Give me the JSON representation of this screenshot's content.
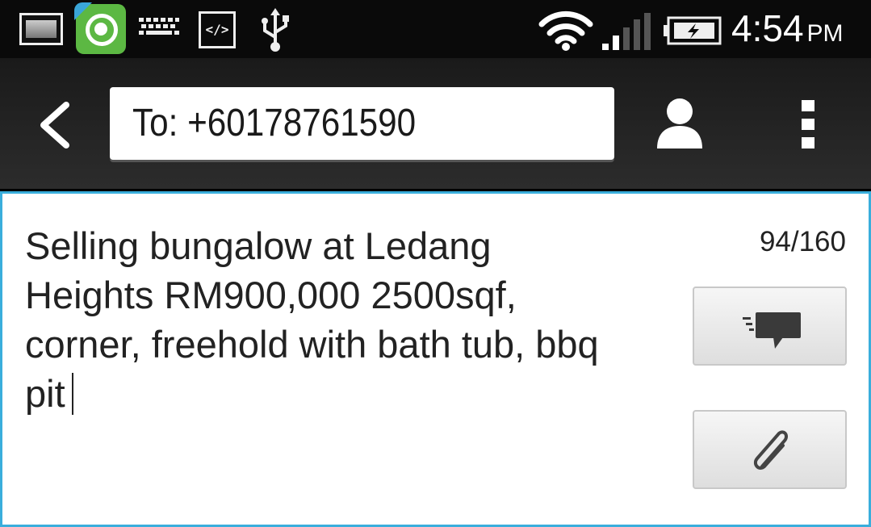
{
  "status_bar": {
    "time": "4:54",
    "ampm": "PM",
    "notification_icons": [
      "gallery-icon",
      "app-pro-icon",
      "keyboard-icon",
      "code-icon",
      "usb-icon"
    ],
    "system_icons": [
      "wifi-icon",
      "signal-icon",
      "battery-charging-icon"
    ]
  },
  "action_bar": {
    "back_icon": "chevron-left-icon",
    "recipient": "To: +60178761590",
    "contact_icon": "person-icon",
    "menu_icon": "overflow-menu-icon"
  },
  "compose": {
    "message_lines": [
      "Selling bungalow at Ledang",
      "Heights RM900,000 2500sqf,",
      "corner, freehold with bath tub, bbq",
      "pit"
    ],
    "char_counter": "94/160",
    "send_icon": "send-message-icon",
    "attach_icon": "paperclip-icon",
    "accent_color": "#3aaedc"
  }
}
